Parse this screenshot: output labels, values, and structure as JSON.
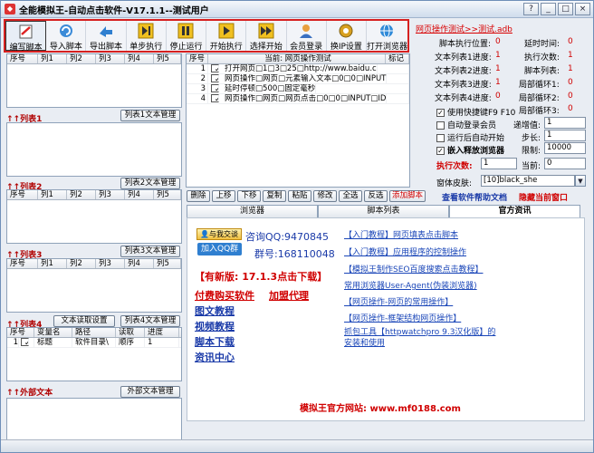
{
  "window": {
    "title": "全能模拟王-自动点击软件-V17.1.1--测试用户"
  },
  "toolbar": {
    "buttons": [
      {
        "label": "编写脚本"
      },
      {
        "label": "导入脚本"
      },
      {
        "label": "导出脚本"
      },
      {
        "label": "单步执行"
      },
      {
        "label": "停止运行"
      },
      {
        "label": "开始执行"
      },
      {
        "label": "选择开始"
      },
      {
        "label": "会员登录"
      },
      {
        "label": "换IP设置"
      },
      {
        "label": "打开浏览器"
      }
    ]
  },
  "file_link": "网页操作测试>>测试.adb",
  "status": {
    "left": [
      {
        "label": "脚本执行位置:",
        "value": "0"
      },
      {
        "label": "文本列表1进度:",
        "value": "1"
      },
      {
        "label": "文本列表2进度:",
        "value": "1"
      },
      {
        "label": "文本列表3进度:",
        "value": "1"
      },
      {
        "label": "文本列表4进度:",
        "value": "0"
      }
    ],
    "right": [
      {
        "label": "延时时间:",
        "value": "0"
      },
      {
        "label": "执行次数:",
        "value": "1"
      },
      {
        "label": "脚本列表:",
        "value": "1"
      },
      {
        "label": "局部循环1:",
        "value": "0"
      },
      {
        "label": "局部循环2:",
        "value": "0"
      },
      {
        "label": "局部循环3:",
        "value": "0"
      }
    ]
  },
  "options": {
    "hotkey": "使用快捷键F9 F10",
    "auto_login": "自动登录会员",
    "auto_start": "运行后自动开始",
    "embed_browser": "嵌入释放浏览器",
    "step_label": "递增值:",
    "step_value": "1",
    "stride_label": "步长:",
    "stride_value": "1",
    "limit_label": "限制:",
    "limit_value": "10000",
    "exec_label": "执行次数:",
    "exec_value": "1",
    "current_label": "当前:",
    "current_value": "0",
    "skin_label": "窗体皮肤:",
    "skin_value": "[10]black_she"
  },
  "lists": {
    "columns": [
      "序号",
      "列1",
      "列2",
      "列3",
      "列4",
      "列5"
    ],
    "list1": {
      "title": "列表1",
      "btn": "列表1文本管理"
    },
    "list2": {
      "title": "列表2",
      "btn": "列表2文本管理"
    },
    "list3": {
      "title": "列表3",
      "btn": "列表3文本管理"
    },
    "list4": {
      "title": "列表4",
      "btn_read": "文本读取设置",
      "btn_manage": "列表4文本管理",
      "columns": [
        "序号",
        "变量名",
        "路径",
        "读取",
        "进度"
      ],
      "rows": [
        {
          "idx": "1",
          "name": "标题",
          "path": "软件目录\\",
          "mode": "顺序",
          "prog": "1"
        }
      ]
    },
    "external": {
      "title": "外部文本",
      "btn": "外部文本管理"
    }
  },
  "script": {
    "cols": {
      "idx": "序号",
      "current": "当前: 网页操作测试",
      "mark": "标记"
    },
    "rows": [
      {
        "n": "1",
        "text": "打开网页□1□3□25□http://www.baidu.c"
      },
      {
        "n": "2",
        "text": "网页操作□网页□元素输入文本□0□0□INPUT"
      },
      {
        "n": "3",
        "text": "延时停顿□500□固定毫秒"
      },
      {
        "n": "4",
        "text": "网页操作□网页□网页点击□0□0□INPUT□ID"
      }
    ],
    "edit_buttons": [
      "删除",
      "上移",
      "下移",
      "复制",
      "粘贴",
      "修改",
      "全选",
      "反选"
    ],
    "add_button": "添加脚本",
    "help_link": "查看软件帮助文档",
    "hide_link": "隐藏当前窗口"
  },
  "tabs": [
    {
      "label": "浏览器"
    },
    {
      "label": "脚本列表"
    },
    {
      "label": "官方资讯"
    }
  ],
  "news": {
    "qq_talk": "与我交谈",
    "qq_consult": "咨询QQ:9470845",
    "qq_group_btn": "加入QQ群",
    "qq_group": "群号:168110048",
    "new_version": "【有新版: 17.1.3点击下载】",
    "buy": "付费购买软件",
    "agent": "加盟代理",
    "links_left": [
      "图文教程",
      "视频教程",
      "脚本下载",
      "资讯中心"
    ],
    "links_right": [
      "【入门教程】网页填表点击脚本",
      "【入门教程】应用程序的控制操作",
      "【模拟王制作SEO百度搜索点击教程】",
      "常用浏览器User-Agent(伪装浏览器)",
      "【网页操作-网页的常用操作】",
      "【网页操作-框架结构网页操作】",
      "抓包工具【httpwatchpro 9.3汉化版】的安装和使用"
    ],
    "official": "模拟王官方网站: www.mf0188.com"
  }
}
